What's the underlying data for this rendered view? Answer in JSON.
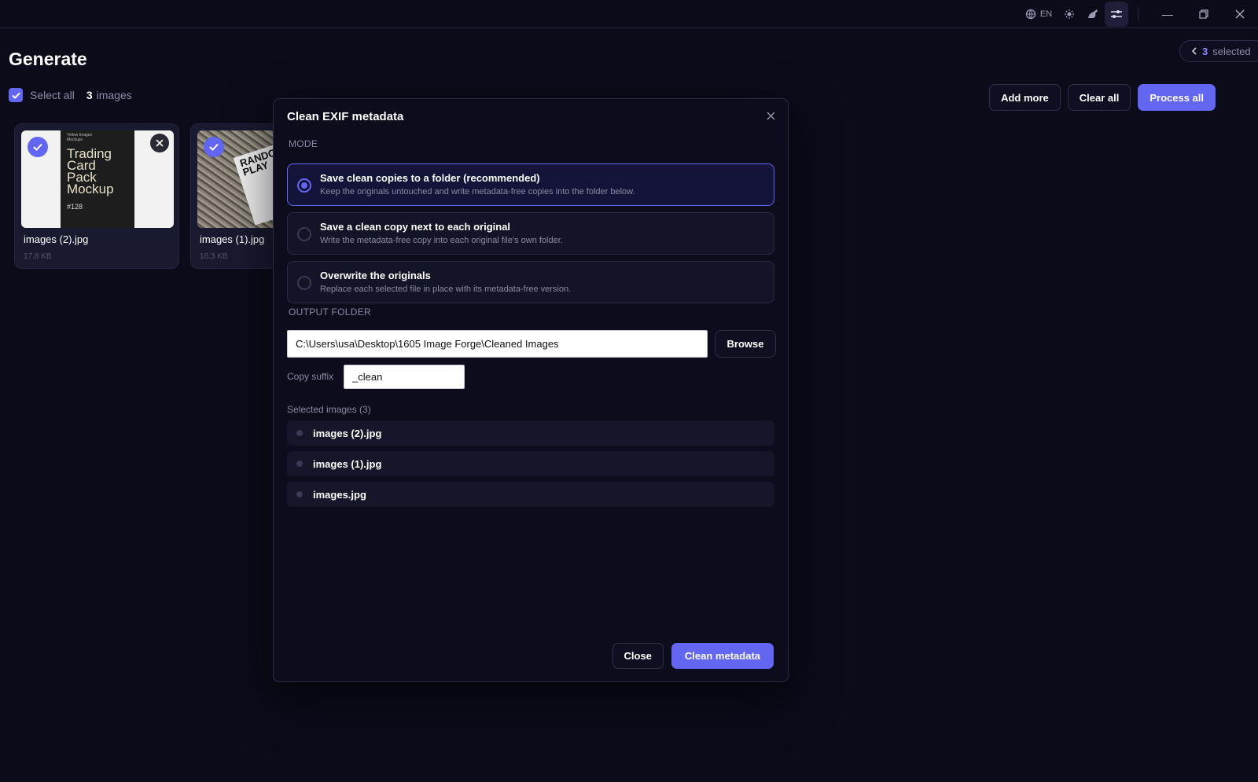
{
  "titlebar": {
    "language": "EN",
    "icons": [
      "globe-icon",
      "brightness-icon",
      "palette-icon",
      "settings-sliders-icon"
    ],
    "window_controls": [
      "minimize-icon",
      "restore-icon",
      "close-icon"
    ]
  },
  "page": {
    "title": "Generate",
    "selection_pill": {
      "count": "3",
      "label": "selected"
    },
    "select_all_label": "Select all",
    "images_count": "3",
    "images_label": "images",
    "actions": {
      "add_more": "Add more",
      "clear_all": "Clear all",
      "process_all": "Process all"
    }
  },
  "cards": [
    {
      "name": "images (2).jpg",
      "size": "17.8 KB",
      "thumb_text": [
        "Yellow Images",
        "Mockups",
        "Trading",
        "Card",
        "Pack",
        "Mockup",
        "#128"
      ]
    },
    {
      "name": "images (1).jpg",
      "size": "16.3 KB",
      "thumb_text": [
        "RANDOM",
        "PLAY"
      ]
    }
  ],
  "modal": {
    "title": "Clean EXIF metadata",
    "mode_label": "MODE",
    "options": [
      {
        "title": "Save clean copies to a folder (recommended)",
        "desc": "Keep the originals untouched and write metadata-free copies into the folder below.",
        "selected": true
      },
      {
        "title": "Save a clean copy next to each original",
        "desc": "Write the metadata-free copy into each original file's own folder.",
        "selected": false
      },
      {
        "title": "Overwrite the originals",
        "desc": "Replace each selected file in place with its metadata-free version.",
        "selected": false
      }
    ],
    "output_label": "OUTPUT FOLDER",
    "output_path": "C:\\Users\\usa\\Desktop\\1605 Image Forge\\Cleaned Images",
    "browse_label": "Browse",
    "suffix_label": "Copy suffix",
    "suffix_value": "_clean",
    "selected_heading": "Selected images (3)",
    "files": [
      "images (2).jpg",
      "images (1).jpg",
      "images.jpg"
    ],
    "close_label": "Close",
    "clean_label": "Clean metadata"
  },
  "colors": {
    "accent": "#6366f1",
    "background": "#0b0b1a",
    "panel": "#0c0c1d"
  }
}
